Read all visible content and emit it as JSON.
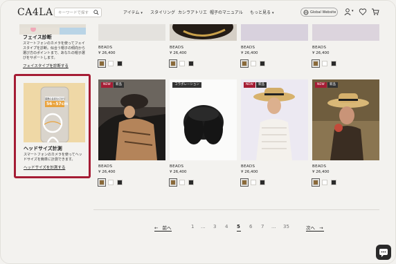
{
  "header": {
    "logo": "CA4LA",
    "search_placeholder": "キーワードで探す",
    "nav": [
      {
        "label": "アイテム",
        "has_caret": true
      },
      {
        "label": "スタイリング",
        "has_caret": false
      },
      {
        "label": "カシラアトリエ",
        "has_caret": false
      },
      {
        "label": "帽子のマニュアル",
        "has_caret": false
      },
      {
        "label": "もっと見る",
        "has_caret": true
      }
    ],
    "global_button": "Global Website",
    "icons": [
      "user-icon",
      "heart-icon",
      "cart-icon"
    ]
  },
  "sidebar": {
    "face": {
      "title": "フェイス診断",
      "description": "スマートフォンのカメラを使ってフェイスタイプを診断。似合う帽子の傾向から選び方のポイントまで、あなたの帽子選びをサポートします。",
      "link": "フェイスタイプを診断する"
    },
    "head": {
      "card_tag": "頭囲の目安をSTEP1",
      "measure": "56~57cm",
      "title": "ヘッドサイズ計測",
      "description": "スマートフォンのカメラを使ってヘッドサイズを簡単に計測できます。",
      "link": "ヘッドサイズを計測する"
    }
  },
  "colors": {
    "accent": "#a51c34",
    "background": "#f3f2ef"
  },
  "products_top": [
    {
      "name": "BEADS",
      "price": "¥ 26,400",
      "swatches": [
        "#8a6a3a",
        "#ffffff",
        "#2a2a2a"
      ]
    },
    {
      "name": "BEADS",
      "price": "¥ 26,400",
      "swatches": [
        "#8a6a3a",
        "#ffffff",
        "#2a2a2a"
      ]
    },
    {
      "name": "BEADS",
      "price": "¥ 26,400",
      "swatches": [
        "#8a6a3a",
        "#ffffff",
        "#2a2a2a"
      ]
    },
    {
      "name": "BEADS",
      "price": "¥ 26,400",
      "swatches": [
        "#8a6a3a",
        "#ffffff",
        "#2a2a2a"
      ]
    }
  ],
  "products_bottom": [
    {
      "name": "BEADS",
      "price": "¥ 26,400",
      "badges": [
        {
          "text": "NEW",
          "kind": "new"
        },
        {
          "text": "新品",
          "kind": "excl"
        }
      ],
      "swatches": [
        "#8a6a3a",
        "#ffffff",
        "#2a2a2a"
      ]
    },
    {
      "name": "BEADS",
      "price": "¥ 26,400",
      "badges": [
        {
          "text": "コラボレーション",
          "kind": "excl"
        }
      ],
      "swatches": [
        "#8a6a3a",
        "#ffffff",
        "#2a2a2a"
      ]
    },
    {
      "name": "BEADS",
      "price": "¥ 26,400",
      "badges": [
        {
          "text": "NEW",
          "kind": "new"
        },
        {
          "text": "新品",
          "kind": "excl"
        }
      ],
      "swatches": [
        "#8a6a3a",
        "#ffffff",
        "#2a2a2a"
      ]
    },
    {
      "name": "BEADS",
      "price": "¥ 26,400",
      "badges": [
        {
          "text": "NEW",
          "kind": "new"
        },
        {
          "text": "新品",
          "kind": "excl"
        }
      ],
      "swatches": [
        "#8a6a3a",
        "#ffffff",
        "#2a2a2a"
      ]
    }
  ],
  "pagination": {
    "prev": "前へ",
    "next": "次へ",
    "pages": [
      "1",
      "...",
      "3",
      "4",
      "5",
      "6",
      "7",
      "...",
      "35"
    ],
    "current": "5"
  },
  "chat_icon": "chat-bubble-icon"
}
